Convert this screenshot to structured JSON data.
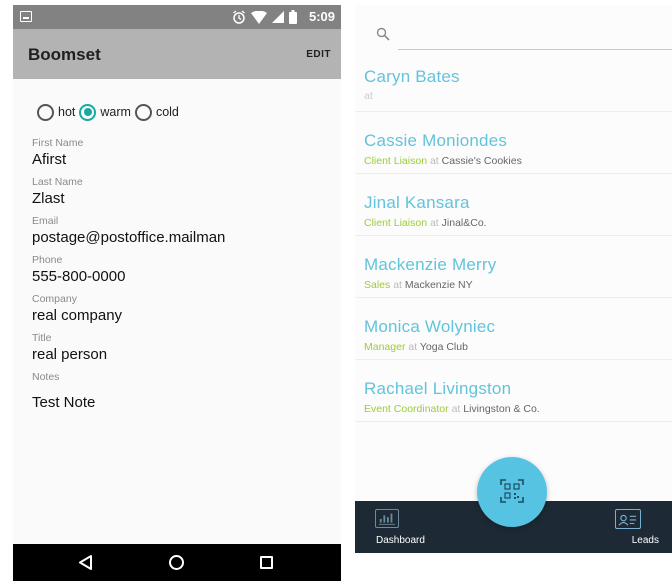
{
  "left_screen": {
    "status_bar": {
      "time": "5:09"
    },
    "app_bar": {
      "title": "Boomset",
      "edit_label": "EDIT"
    },
    "temperature": {
      "options": [
        {
          "label": "hot",
          "checked": false
        },
        {
          "label": "warm",
          "checked": true
        },
        {
          "label": "cold",
          "checked": false
        }
      ]
    },
    "fields": [
      {
        "label": "First Name",
        "value": "Afirst"
      },
      {
        "label": "Last Name",
        "value": "Zlast"
      },
      {
        "label": "Email",
        "value": "postage@postoffice.mailman"
      },
      {
        "label": "Phone",
        "value": "555-800-0000"
      },
      {
        "label": "Company",
        "value": "real company"
      },
      {
        "label": "Title",
        "value": "real person"
      },
      {
        "label": "Notes",
        "value": "Test Note"
      }
    ]
  },
  "right_screen": {
    "search": {
      "placeholder": ""
    },
    "contacts": [
      {
        "name": "Caryn Bates",
        "role": "",
        "at": "at",
        "company": ""
      },
      {
        "name": "Cassie Moniondes",
        "role": "Client Liaison",
        "at": "at",
        "company": "Cassie's Cookies"
      },
      {
        "name": "Jinal  Kansara",
        "role": "Client Liaison",
        "at": "at",
        "company": "Jinal&Co."
      },
      {
        "name": "Mackenzie  Merry",
        "role": "Sales",
        "at": "at",
        "company": "Mackenzie NY"
      },
      {
        "name": "Monica  Wolyniec",
        "role": "Manager",
        "at": "at",
        "company": "Yoga Club"
      },
      {
        "name": "Rachael Livingston",
        "role": "Event Coordinator",
        "at": "at",
        "company": "Livingston & Co."
      }
    ],
    "bottom_nav": {
      "dashboard_label": "Dashboard",
      "leads_label": "Leads"
    }
  },
  "colors": {
    "accent_teal": "#17a9a3",
    "contact_name": "#62c4dc",
    "role_green": "#9ccc3a",
    "bottom_bar": "#1d2a35",
    "fab": "#56c3e3"
  },
  "icons": [
    "image-icon",
    "alarm-icon",
    "wifi-icon",
    "signal-icon",
    "battery-icon",
    "back-icon",
    "home-icon",
    "recents-icon",
    "search-icon",
    "dashboard-icon",
    "qr-scan-icon",
    "leads-icon"
  ]
}
